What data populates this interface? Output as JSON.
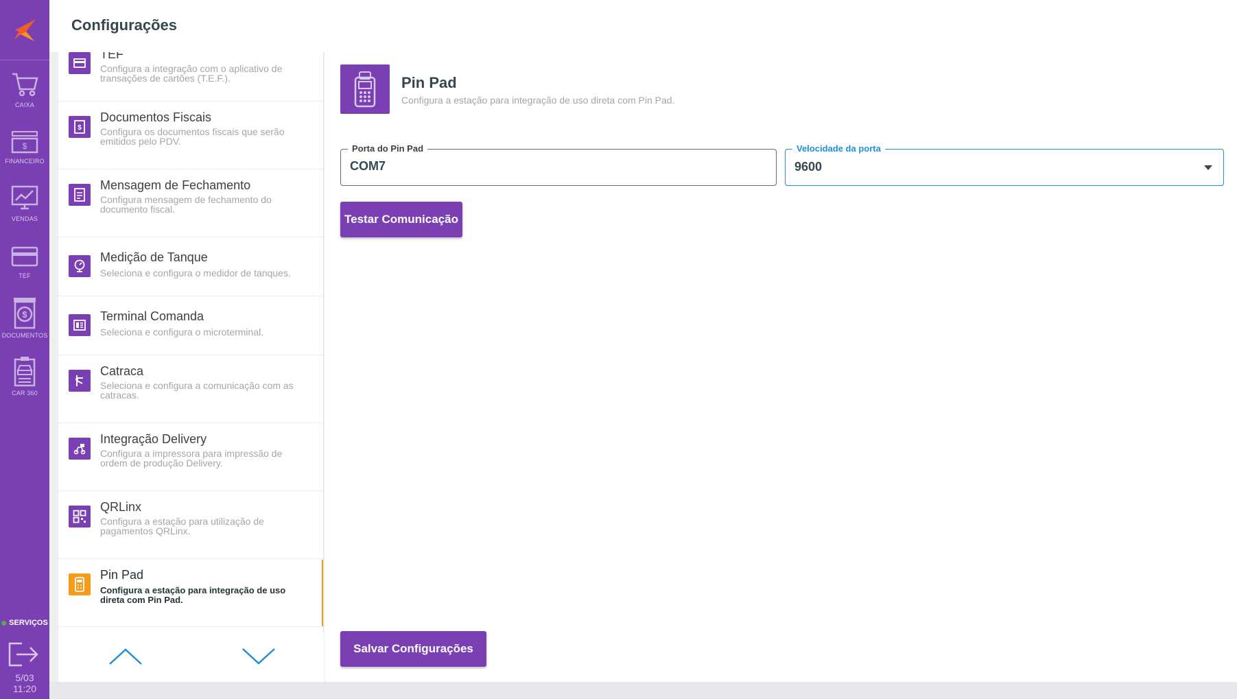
{
  "header": {
    "title": "Configurações"
  },
  "sidebar": {
    "items": [
      {
        "label": "CAIXA",
        "icon": "cart-icon"
      },
      {
        "label": "FINANCEIRO",
        "icon": "cash-icon"
      },
      {
        "label": "VENDAS",
        "icon": "monitor-chart-icon"
      },
      {
        "label": "TEF",
        "icon": "card-icon"
      },
      {
        "label": "DOCUMENTOS",
        "icon": "document-dollar-icon"
      },
      {
        "label": "CAR 360",
        "icon": "car-clipboard-icon"
      }
    ],
    "services_label": "SERVIÇOS",
    "date": "5/03",
    "time": "11:20"
  },
  "settings_list": [
    {
      "title": "TEF",
      "desc": "Configura a integração com o aplicativo de transações de cartões (T.E.F.)."
    },
    {
      "title": "Documentos Fiscais",
      "desc": "Configura os documentos fiscais que serão emitidos pelo PDV."
    },
    {
      "title": "Mensagem de Fechamento",
      "desc": "Configura mensagem de fechamento do documento fiscal."
    },
    {
      "title": "Medição de Tanque",
      "desc": "Seleciona e configura o medidor de tanques."
    },
    {
      "title": "Terminal Comanda",
      "desc": "Seleciona e configura o microterminal."
    },
    {
      "title": "Catraca",
      "desc": "Seleciona e configura a comunicação com as catracas."
    },
    {
      "title": "Integração Delivery",
      "desc": "Configura a impressora para impressão de ordem de produção Delivery."
    },
    {
      "title": "QRLinx",
      "desc": "Configura a estação para utilização de pagamentos QRLinx."
    },
    {
      "title": "Pin Pad",
      "desc": "Configura a estação para integração de uso direta com Pin Pad."
    }
  ],
  "detail": {
    "title": "Pin Pad",
    "subtitle": "Configura a estação para integração de uso direta com Pin Pad.",
    "port_label": "Porta do Pin Pad",
    "port_value": "COM7",
    "speed_label": "Velocidade da porta",
    "speed_value": "9600",
    "test_button": "Testar Comunicação",
    "save_button": "Salvar Configurações"
  },
  "colors": {
    "brand": "#7a3fb3",
    "active": "#f59c1a",
    "focus": "#1e8fd8"
  }
}
